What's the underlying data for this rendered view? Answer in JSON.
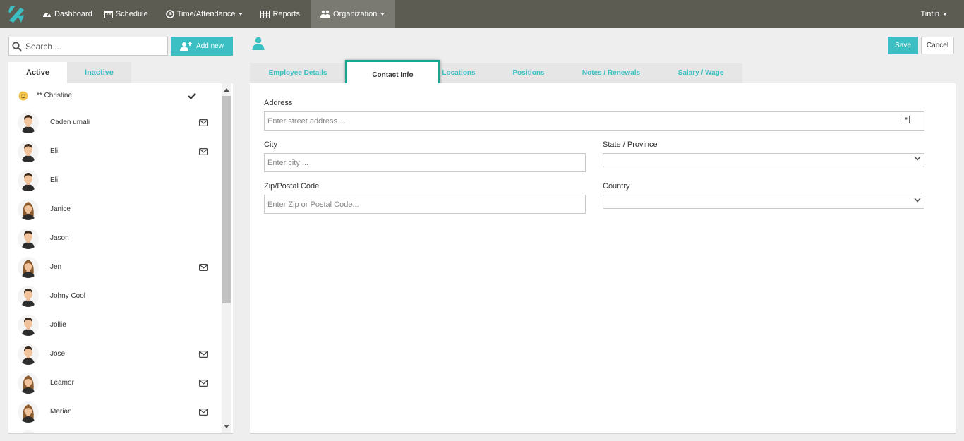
{
  "brand": {
    "accent": "#3bbfc3",
    "nav_bg": "#5c5c52",
    "highlight": "#17a58f"
  },
  "nav": {
    "logo_icon": "brand-logo-icon",
    "items": [
      {
        "label": "Dashboard",
        "icon": "dashboard-icon"
      },
      {
        "label": "Schedule",
        "icon": "calendar-icon"
      },
      {
        "label": "Time/Attendance",
        "icon": "clock-icon",
        "dropdown": true
      },
      {
        "label": "Reports",
        "icon": "table-icon"
      },
      {
        "label": "Organization",
        "icon": "users-icon",
        "dropdown": true,
        "active": true
      }
    ],
    "user": "Tintin"
  },
  "sidebar": {
    "search_placeholder": "Search ...",
    "add_new_label": "Add new",
    "tabs": [
      {
        "label": "Active",
        "active": true
      },
      {
        "label": "Inactive"
      }
    ],
    "employees": [
      {
        "name": "** Christine",
        "avatar": "smiley",
        "checked": true,
        "mail": false
      },
      {
        "name": "Caden umali",
        "avatar": "male",
        "mail": true
      },
      {
        "name": "Eli",
        "avatar": "male",
        "mail": true
      },
      {
        "name": "Eli",
        "avatar": "male",
        "mail": false
      },
      {
        "name": "Janice",
        "avatar": "female",
        "mail": false
      },
      {
        "name": "Jason",
        "avatar": "male",
        "mail": false
      },
      {
        "name": "Jen",
        "avatar": "female",
        "mail": true
      },
      {
        "name": "Johny Cool",
        "avatar": "male",
        "mail": false
      },
      {
        "name": "Jollie",
        "avatar": "male",
        "mail": false
      },
      {
        "name": "Jose",
        "avatar": "male",
        "mail": true
      },
      {
        "name": "Leamor",
        "avatar": "female",
        "mail": true
      },
      {
        "name": "Marian",
        "avatar": "female",
        "mail": true
      },
      {
        "name": "",
        "avatar": "female",
        "mail": false
      }
    ]
  },
  "header": {
    "save_label": "Save",
    "cancel_label": "Cancel",
    "profile_icon": "user-icon"
  },
  "tabs": [
    {
      "label": "Employee Details"
    },
    {
      "label": "Contact Info",
      "active": true
    },
    {
      "label": "Locations"
    },
    {
      "label": "Positions"
    },
    {
      "label": "Notes / Renewals"
    },
    {
      "label": "Salary / Wage"
    }
  ],
  "form": {
    "address_label": "Address",
    "address_placeholder": "Enter street address ...",
    "city_label": "City",
    "city_placeholder": "Enter city ...",
    "state_label": "State / Province",
    "state_value": "",
    "zip_label": "Zip/Postal Code",
    "zip_placeholder": "Enter Zip or Postal Code...",
    "country_label": "Country",
    "country_value": ""
  }
}
